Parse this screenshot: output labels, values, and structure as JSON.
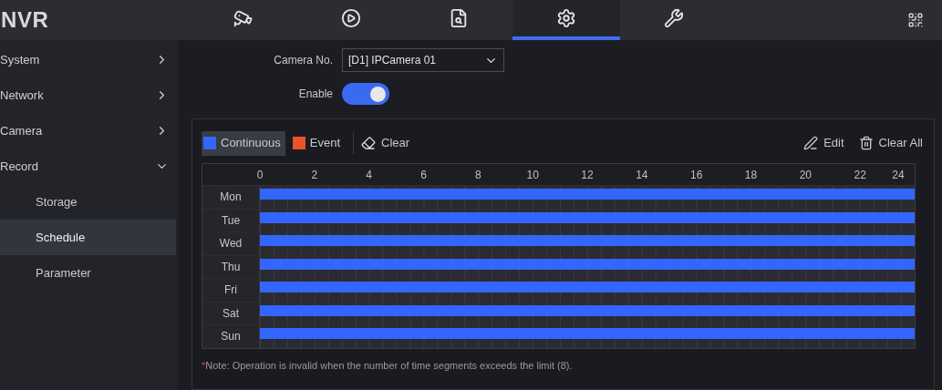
{
  "header": {
    "logo": "NVR",
    "tabs": [
      {
        "selected": false
      },
      {
        "selected": false
      },
      {
        "selected": false
      },
      {
        "selected": true
      },
      {
        "selected": false
      }
    ]
  },
  "sidebar": {
    "items": [
      {
        "label": "System",
        "expanded": false
      },
      {
        "label": "Network",
        "expanded": false
      },
      {
        "label": "Camera",
        "expanded": false
      },
      {
        "label": "Record",
        "expanded": true,
        "children": [
          {
            "label": "Storage",
            "selected": false
          },
          {
            "label": "Schedule",
            "selected": true
          },
          {
            "label": "Parameter",
            "selected": false
          }
        ]
      }
    ]
  },
  "camera_no": {
    "label": "Camera No.",
    "value": "[D1] IPCamera 01"
  },
  "enable": {
    "label": "Enable",
    "on": true
  },
  "toolbar": {
    "legend": [
      {
        "label": "Continuous",
        "color": "#3366ff",
        "selected": true
      },
      {
        "label": "Event",
        "color": "#e8532c",
        "selected": false
      }
    ],
    "clear": "Clear",
    "edit": "Edit",
    "clear_all": "Clear All"
  },
  "schedule": {
    "hours": [
      "0",
      "2",
      "4",
      "6",
      "8",
      "10",
      "12",
      "14",
      "16",
      "18",
      "20",
      "22",
      "24"
    ],
    "days": [
      {
        "label": "Mon",
        "level": 1,
        "color": "#3366ff"
      },
      {
        "label": "Tue",
        "level": 1,
        "color": "#3366ff"
      },
      {
        "label": "Wed",
        "level": 1,
        "color": "#3366ff"
      },
      {
        "label": "Thu",
        "level": 1,
        "color": "#3366ff"
      },
      {
        "label": "Fri",
        "level": 1,
        "color": "#3366ff"
      },
      {
        "label": "Sat",
        "level": 1,
        "color": "#3366ff"
      },
      {
        "label": "Sun",
        "level": 1,
        "color": "#3366ff"
      }
    ]
  },
  "note_mark": "*",
  "note": "Note: Operation is invalid when the number of time segments exceeds the limit (8)."
}
